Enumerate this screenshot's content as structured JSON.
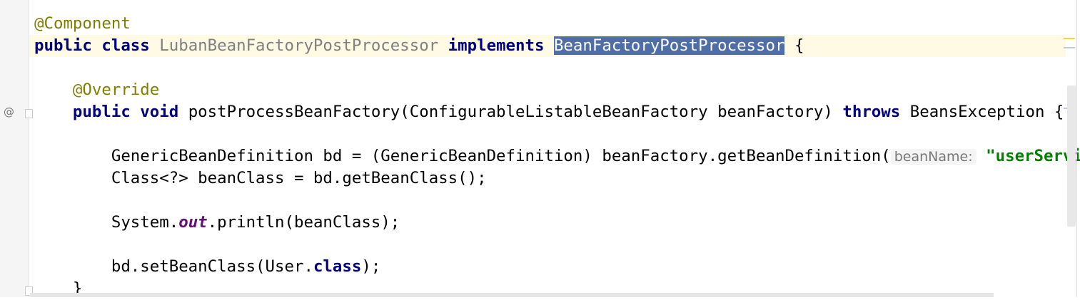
{
  "editor": {
    "gutter_icon": "@",
    "lines": {
      "l0": {
        "ann": "@Component"
      },
      "l1": {
        "kw1": "public class ",
        "name": "LubanBeanFactoryPostProcessor",
        "kw2": " implements ",
        "sel": "BeanFactoryPostProcessor",
        "rest": " {"
      },
      "l3": {
        "ann": "@Override"
      },
      "l4": {
        "kw1": "public void ",
        "text": "postProcessBeanFactory(ConfigurableListableBeanFactory beanFactory) ",
        "kw2": "throws",
        "rest": " BeansException {"
      },
      "l6": {
        "text": "GenericBeanDefinition bd = (GenericBeanDefinition) beanFactory.getBeanDefinition(",
        "hint": "beanName:",
        "str": "\"userService"
      },
      "l7": {
        "text": "Class<?> beanClass = bd.getBeanClass();"
      },
      "l9": {
        "pre": "System.",
        "static": "out",
        "post": ".println(beanClass);"
      },
      "l11": {
        "pre": "bd.setBeanClass(User.",
        "kw": "class",
        "post": ");"
      },
      "l12": {
        "text": "}"
      }
    },
    "colors": {
      "keyword": "#000080",
      "annotation": "#808000",
      "string": "#008000",
      "selection": "#4f6ea8",
      "current_line": "#fffae3"
    }
  }
}
